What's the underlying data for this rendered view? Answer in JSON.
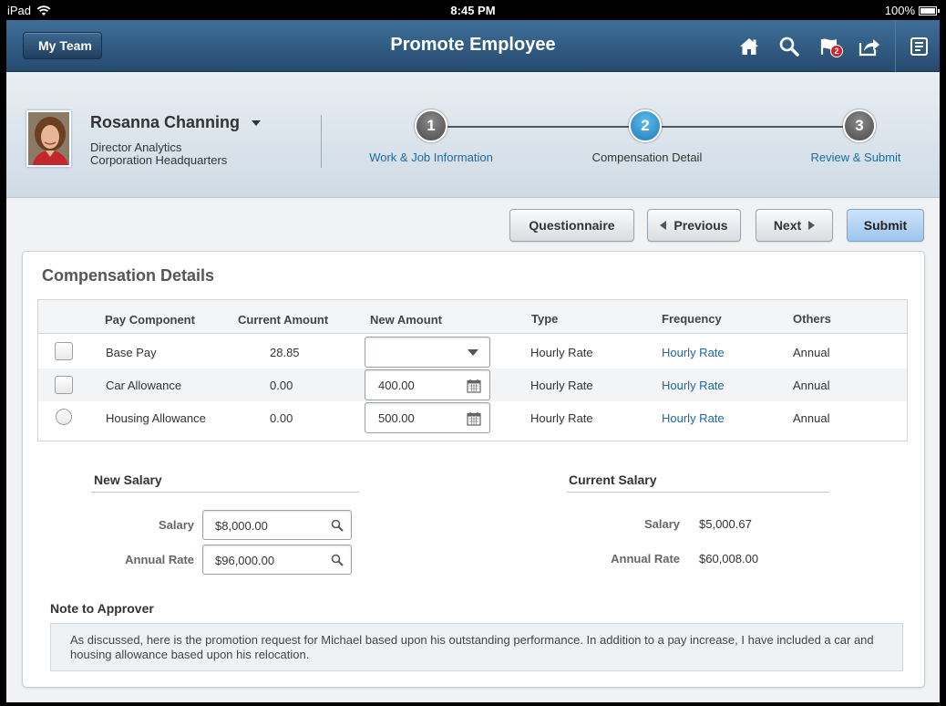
{
  "status_bar": {
    "device": "iPad",
    "time": "8:45 PM",
    "battery": "100%"
  },
  "navbar": {
    "back_label": "My Team",
    "title": "Promote Employee",
    "icons": [
      "home-icon",
      "search-icon",
      "notifications-icon",
      "share-icon",
      "menu-icon"
    ],
    "notification_count": "2"
  },
  "employee": {
    "name": "Rosanna Channing",
    "title": "Director Analytics",
    "department": "Corporation Headquarters"
  },
  "train": {
    "steps": [
      {
        "number": "1",
        "label": "Work & Job Information",
        "state": "done"
      },
      {
        "number": "2",
        "label": "Compensation Detail",
        "state": "active"
      },
      {
        "number": "3",
        "label": "Review & Submit",
        "state": "pending"
      }
    ]
  },
  "actions": {
    "questionnaire": "Questionnaire",
    "previous": "Previous",
    "next": "Next",
    "submit": "Submit"
  },
  "compensation": {
    "title": "Compensation Details",
    "columns": [
      "Pay Component",
      "Current Amount",
      "New Amount",
      "Type",
      "Frequency",
      "Others"
    ],
    "rows": [
      {
        "component": "Base Pay",
        "current": "28.85",
        "new_amount": "",
        "type": "Hourly Rate",
        "frequency": "Hourly Rate",
        "others": "Annual"
      },
      {
        "component": "Car Allowance",
        "current": "0.00",
        "new_amount": "400.00",
        "type": "Hourly Rate",
        "frequency": "Hourly Rate",
        "others": "Annual"
      },
      {
        "component": "Housing Allowance",
        "current": "0.00",
        "new_amount": "500.00",
        "type": "Hourly Rate",
        "frequency": "Hourly Rate",
        "others": "Annual"
      }
    ]
  },
  "new_salary": {
    "title": "New Salary",
    "salary_label": "Salary",
    "salary_value": "$8,000.00",
    "annual_label": "Annual Rate",
    "annual_value": "$96,000.00"
  },
  "current_salary": {
    "title": "Current Salary",
    "salary_label": "Salary",
    "salary_value": "$5,000.67",
    "annual_label": "Annual Rate",
    "annual_value": "$60,008.00"
  },
  "note": {
    "title": "Note to Approver",
    "text": "As discussed, here is the promotion request for Michael based upon his outstanding performance. In addition to a pay increase, I have included a car and housing allowance based upon his relocation."
  },
  "colors": {
    "nav_top": "#3f6f99",
    "nav_bottom": "#264a6f",
    "link": "#1c6aa0",
    "active_step": "#1d7cb8",
    "badge": "#d2242b"
  }
}
